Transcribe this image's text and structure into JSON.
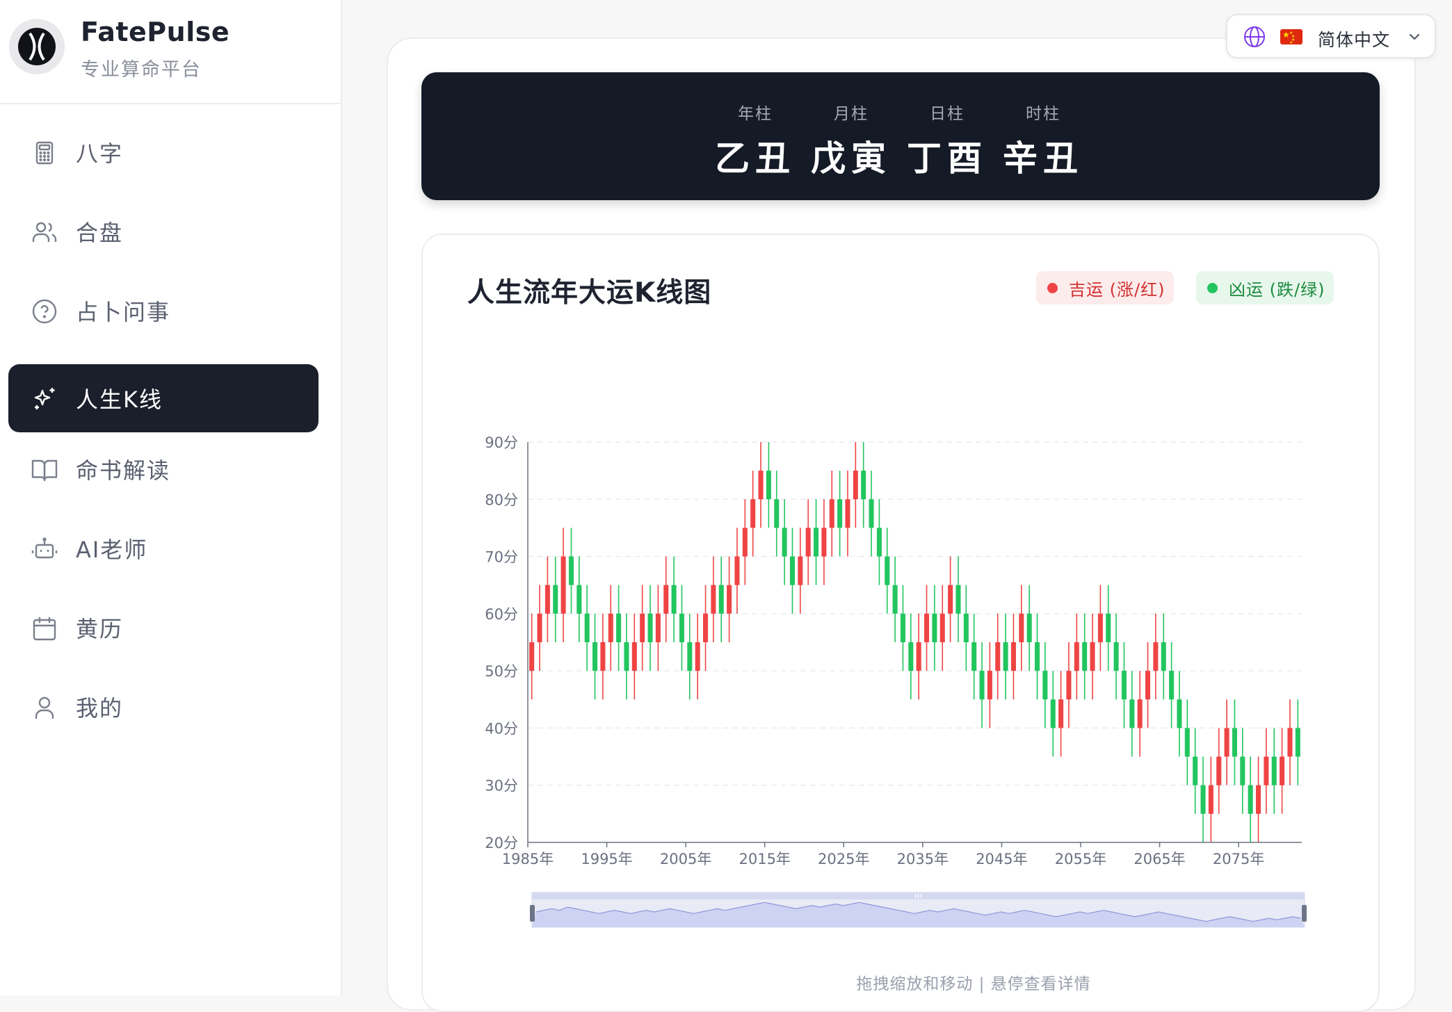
{
  "brand": {
    "name": "FatePulse",
    "subtitle": "专业算命平台"
  },
  "sidebar": {
    "items": [
      {
        "label": "八字",
        "icon": "calculator-icon",
        "active": false
      },
      {
        "label": "合盘",
        "icon": "users-icon",
        "active": false
      },
      {
        "label": "占卜问事",
        "icon": "help-circle-icon",
        "active": false
      },
      {
        "label": "人生K线",
        "icon": "sparkles-icon",
        "active": true
      },
      {
        "label": "命书解读",
        "icon": "book-open-icon",
        "active": false
      },
      {
        "label": "AI老师",
        "icon": "bot-icon",
        "active": false
      },
      {
        "label": "黄历",
        "icon": "calendar-icon",
        "active": false
      },
      {
        "label": "我的",
        "icon": "user-icon",
        "active": false
      }
    ]
  },
  "language": {
    "label": "简体中文",
    "flag": "cn-flag-icon"
  },
  "pillars": [
    {
      "label": "年柱",
      "value": "乙丑"
    },
    {
      "label": "月柱",
      "value": "戊寅"
    },
    {
      "label": "日柱",
      "value": "丁酉"
    },
    {
      "label": "时柱",
      "value": "辛丑"
    }
  ],
  "chart": {
    "title": "人生流年大运K线图",
    "legend_up": "吉运 (涨/红)",
    "legend_down": "凶运 (跌/绿)",
    "hint": "拖拽缩放和移动 | 悬停查看详情"
  },
  "colors": {
    "up": "#ef4444",
    "down": "#22c55e",
    "sidebar_active": "#1b1f2b",
    "pillar_bg": "#151a27"
  },
  "chart_data": {
    "type": "candlestick",
    "y_unit": "分",
    "ylim": [
      20,
      90
    ],
    "y_ticks": [
      "20分",
      "30分",
      "40分",
      "50分",
      "60分",
      "70分",
      "80分",
      "90分"
    ],
    "x_ticks": [
      "1985年",
      "1995年",
      "2005年",
      "2015年",
      "2025年",
      "2035年",
      "2045年",
      "2055年",
      "2065年",
      "2075年"
    ],
    "start_year": 1985,
    "grid": true,
    "candles": [
      [
        50,
        55,
        45,
        60
      ],
      [
        55,
        60,
        50,
        65
      ],
      [
        60,
        65,
        55,
        70
      ],
      [
        65,
        60,
        55,
        70
      ],
      [
        60,
        70,
        55,
        75
      ],
      [
        70,
        65,
        60,
        75
      ],
      [
        65,
        60,
        55,
        70
      ],
      [
        60,
        55,
        50,
        65
      ],
      [
        55,
        50,
        45,
        60
      ],
      [
        50,
        55,
        45,
        60
      ],
      [
        55,
        60,
        50,
        65
      ],
      [
        60,
        55,
        50,
        65
      ],
      [
        55,
        50,
        45,
        60
      ],
      [
        50,
        55,
        45,
        60
      ],
      [
        55,
        60,
        50,
        65
      ],
      [
        60,
        55,
        50,
        65
      ],
      [
        55,
        60,
        50,
        65
      ],
      [
        60,
        65,
        55,
        70
      ],
      [
        65,
        60,
        55,
        70
      ],
      [
        60,
        55,
        50,
        65
      ],
      [
        55,
        50,
        45,
        60
      ],
      [
        50,
        55,
        45,
        60
      ],
      [
        55,
        60,
        50,
        65
      ],
      [
        60,
        65,
        55,
        70
      ],
      [
        65,
        60,
        55,
        70
      ],
      [
        60,
        65,
        55,
        70
      ],
      [
        65,
        70,
        60,
        75
      ],
      [
        70,
        75,
        65,
        80
      ],
      [
        75,
        80,
        70,
        85
      ],
      [
        80,
        85,
        75,
        90
      ],
      [
        85,
        80,
        75,
        90
      ],
      [
        80,
        75,
        70,
        85
      ],
      [
        75,
        70,
        65,
        80
      ],
      [
        70,
        65,
        60,
        75
      ],
      [
        65,
        70,
        60,
        75
      ],
      [
        70,
        75,
        65,
        80
      ],
      [
        75,
        70,
        65,
        80
      ],
      [
        70,
        75,
        65,
        80
      ],
      [
        75,
        80,
        70,
        85
      ],
      [
        80,
        75,
        70,
        85
      ],
      [
        75,
        80,
        70,
        85
      ],
      [
        80,
        85,
        75,
        90
      ],
      [
        85,
        80,
        75,
        90
      ],
      [
        80,
        75,
        70,
        85
      ],
      [
        75,
        70,
        65,
        80
      ],
      [
        70,
        65,
        60,
        75
      ],
      [
        65,
        60,
        55,
        70
      ],
      [
        60,
        55,
        50,
        65
      ],
      [
        55,
        50,
        45,
        60
      ],
      [
        50,
        55,
        45,
        60
      ],
      [
        55,
        60,
        50,
        65
      ],
      [
        60,
        55,
        50,
        65
      ],
      [
        55,
        60,
        50,
        65
      ],
      [
        60,
        65,
        55,
        70
      ],
      [
        65,
        60,
        55,
        70
      ],
      [
        60,
        55,
        50,
        65
      ],
      [
        55,
        50,
        45,
        60
      ],
      [
        50,
        45,
        40,
        55
      ],
      [
        45,
        50,
        40,
        55
      ],
      [
        50,
        55,
        45,
        60
      ],
      [
        55,
        50,
        45,
        60
      ],
      [
        50,
        55,
        45,
        60
      ],
      [
        55,
        60,
        50,
        65
      ],
      [
        60,
        55,
        50,
        65
      ],
      [
        55,
        50,
        45,
        60
      ],
      [
        50,
        45,
        40,
        55
      ],
      [
        45,
        40,
        35,
        50
      ],
      [
        40,
        45,
        35,
        50
      ],
      [
        45,
        50,
        40,
        55
      ],
      [
        50,
        55,
        45,
        60
      ],
      [
        55,
        50,
        45,
        60
      ],
      [
        50,
        55,
        45,
        60
      ],
      [
        55,
        60,
        50,
        65
      ],
      [
        60,
        55,
        50,
        65
      ],
      [
        55,
        50,
        45,
        60
      ],
      [
        50,
        45,
        40,
        55
      ],
      [
        45,
        40,
        35,
        50
      ],
      [
        40,
        45,
        35,
        50
      ],
      [
        45,
        50,
        40,
        55
      ],
      [
        50,
        55,
        45,
        60
      ],
      [
        55,
        50,
        45,
        60
      ],
      [
        50,
        45,
        40,
        55
      ],
      [
        45,
        40,
        35,
        50
      ],
      [
        40,
        35,
        30,
        45
      ],
      [
        35,
        30,
        25,
        40
      ],
      [
        30,
        25,
        20,
        35
      ],
      [
        25,
        30,
        20,
        35
      ],
      [
        30,
        35,
        25,
        40
      ],
      [
        35,
        40,
        30,
        45
      ],
      [
        40,
        35,
        30,
        45
      ],
      [
        35,
        30,
        25,
        40
      ],
      [
        30,
        25,
        20,
        35
      ],
      [
        25,
        30,
        20,
        35
      ],
      [
        30,
        35,
        25,
        40
      ],
      [
        35,
        30,
        25,
        40
      ],
      [
        30,
        35,
        25,
        40
      ],
      [
        35,
        40,
        30,
        45
      ],
      [
        40,
        35,
        30,
        45
      ]
    ]
  }
}
